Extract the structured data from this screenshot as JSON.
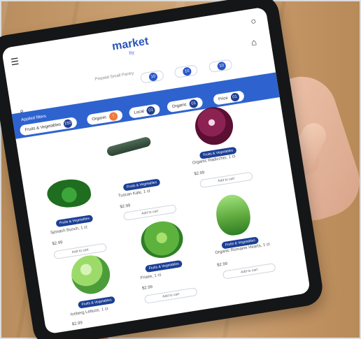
{
  "app": {
    "title": "market",
    "subtitle": "by"
  },
  "header": {
    "delivery_text": "Prepaid Small Pantry",
    "pills": [
      {
        "label": "",
        "count": "10"
      },
      {
        "label": "",
        "count": "10"
      },
      {
        "label": "",
        "count": "10"
      }
    ]
  },
  "filters": {
    "title": "Applied filters",
    "chips": [
      {
        "label": "Fruits & Vegetables",
        "count": "150"
      },
      {
        "label": "Organic",
        "count": "!"
      },
      {
        "label": "Local",
        "count": "01"
      },
      {
        "label": "Organic",
        "count": "01"
      },
      {
        "label": "Price",
        "count": "01"
      }
    ]
  },
  "products": [
    {
      "tag": "Fruits & Vegetables",
      "name": "Organic Radicchio, 1 ct",
      "price": "$2.99",
      "button": "Add to cart",
      "icon": "radicchio-icon"
    },
    {
      "tag": "Fruits & Vegetables",
      "name": "Tuscan Kale, 1 ct",
      "price": "$2.99",
      "button": "Add to cart",
      "icon": "kale-icon"
    },
    {
      "tag": "Fruits & Vegetables",
      "name": "Spinach Bunch, 1 ct",
      "price": "$2.99",
      "button": "Add to cart",
      "icon": "spinach-icon"
    },
    {
      "tag": "Fruits & Vegetables",
      "name": "Organic Romaine Hearts, 1 ct",
      "price": "$2.99",
      "button": "Add to cart",
      "icon": "romaine-icon"
    },
    {
      "tag": "Fruits & Vegetables",
      "name": "Frisee, 1 ct",
      "price": "$2.99",
      "button": "Add to cart",
      "icon": "frisee-icon"
    },
    {
      "tag": "Fruits & Vegetables",
      "name": "Iceberg Lettuce, 1 ct",
      "price": "$2.99",
      "button": "Add to cart",
      "icon": "iceberg-icon"
    }
  ]
}
